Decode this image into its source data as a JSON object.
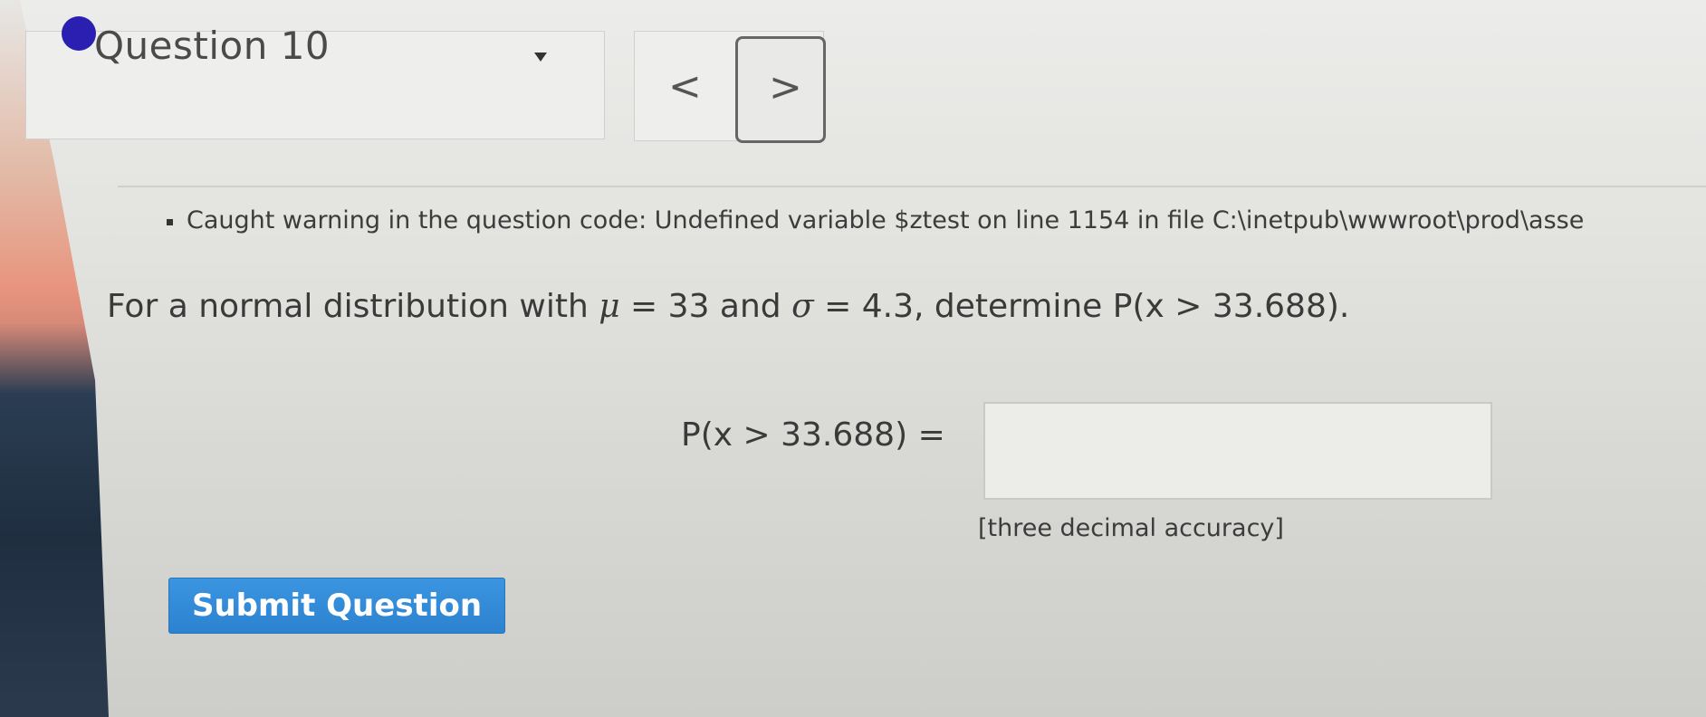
{
  "question": {
    "label": "Question 10",
    "status_color": "#2a1fb0"
  },
  "nav": {
    "prev_glyph": "<",
    "next_glyph": ">"
  },
  "warning": {
    "text": "Caught warning in the question code: Undefined variable $ztest on line 1154 in file C:\\inetpub\\wwwroot\\prod\\asse"
  },
  "prompt": {
    "before_mu": "For a normal distribution with ",
    "mu_symbol": "μ",
    "mu_value": " = 33 and ",
    "sigma_symbol": "σ",
    "sigma_value": " = 4.3, determine P(x > 33.688)."
  },
  "answer": {
    "label": "P(x > 33.688) =",
    "value": "",
    "note": "[three decimal accuracy]"
  },
  "submit": {
    "label": "Submit Question"
  },
  "colors": {
    "submit_bg": "#2c82cf"
  }
}
